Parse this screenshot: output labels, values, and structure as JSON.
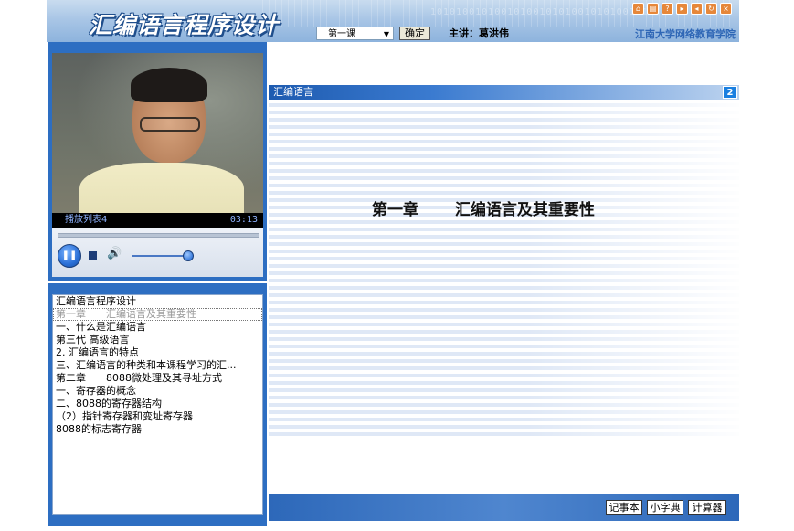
{
  "header": {
    "app_title": "汇编语言程序设计",
    "lesson_select_value": "第一课",
    "confirm_label": "确定",
    "lecturer": "主讲：葛洪伟",
    "school": "江南大学网络教育学院",
    "window_icons": [
      "home-icon",
      "print-icon",
      "help-icon",
      "forward-icon",
      "back-icon",
      "refresh-icon",
      "close-icon"
    ]
  },
  "player": {
    "playlist_label": "播放列表4",
    "time": "03:13"
  },
  "toc": {
    "items": [
      "汇编语言程序设计",
      "第一章　　汇编语言及其重要性",
      "一、什么是汇编语言",
      "第三代 高级语言",
      "2. 汇编语言的特点",
      "三、汇编语言的种类和本课程学习的汇...",
      "第二章　　8088微处理及其寻址方式",
      "一、寄存器的概念",
      "二、8088的寄存器结构",
      "（2）指针寄存器和变址寄存器",
      "8088的标志寄存器"
    ],
    "active_index": 1
  },
  "slide": {
    "title": "汇编语言",
    "page_number": "2",
    "heading": "第一章　　 汇编语言及其重要性"
  },
  "tools": {
    "notepad": "记事本",
    "dictionary": "小字典",
    "calculator": "计算器"
  },
  "colors": {
    "frame_blue": "#2d6ec2",
    "slide_bar_blue": "#1e5bb0",
    "school_text": "#2f67b6"
  }
}
